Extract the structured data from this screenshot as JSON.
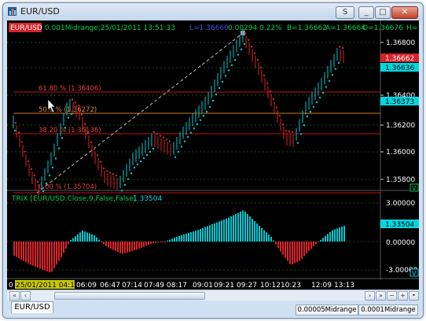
{
  "window": {
    "title": "EUR/USD",
    "buttons": {
      "s_label": "S",
      "min_label": "_",
      "max_label": "□",
      "close_label": "✕"
    }
  },
  "chart": {
    "symbol_badge": "EUR/USD",
    "info_text": "0.001Midrange,25/01/2011  13:51:33",
    "info_low": "L=1.36660",
    "info_change": "0.00294  0.22%",
    "info_bid": "B=1.36662",
    "info_ask": "A=1.36664",
    "info_open": "O=1.36676",
    "info_high": "H=",
    "price_axis_ticks": [
      "1.36800",
      "1.36600",
      "1.36400",
      "1.36200",
      "1.36000",
      "1.35800"
    ],
    "price_badges": {
      "bid": "1.36662",
      "last": "1.36636",
      "fib": "1.36373"
    },
    "fib_labels": [
      "61.80 % (1.36406)",
      "50.0 % (1.36272)",
      "38.20 % (1.36136)",
      "0.00 % (1.35704)"
    ],
    "scroll_marker_top": "V",
    "indicator_label": "TRIX  [EUR/USD.Close,9,False,False]",
    "indicator_value_label": "1.33504",
    "indicator_axis_ticks": [
      "3.00000",
      "1.33504",
      "0.00000",
      "-3.00000"
    ],
    "scroll_marker_bottom": "V",
    "time_start": "25/01/2011 04:18",
    "time_labels": [
      "06:09",
      "06:47",
      "07:14",
      "07:49",
      "08:17",
      "09:01",
      "09:21",
      "09:27",
      "10:12",
      "10:23",
      "12:09",
      "13:13"
    ],
    "time_prefix": "0",
    "colors": {
      "up": "#00c8d2",
      "down": "#d8232a",
      "fib_red": "#c0111a",
      "fib_orange": "#d87a1e",
      "grid": "#2a6b2a"
    }
  },
  "tabs": {
    "active": "EUR/USD",
    "bottom": [
      "0.00005Midrange",
      "0.0001Midrange"
    ]
  }
}
